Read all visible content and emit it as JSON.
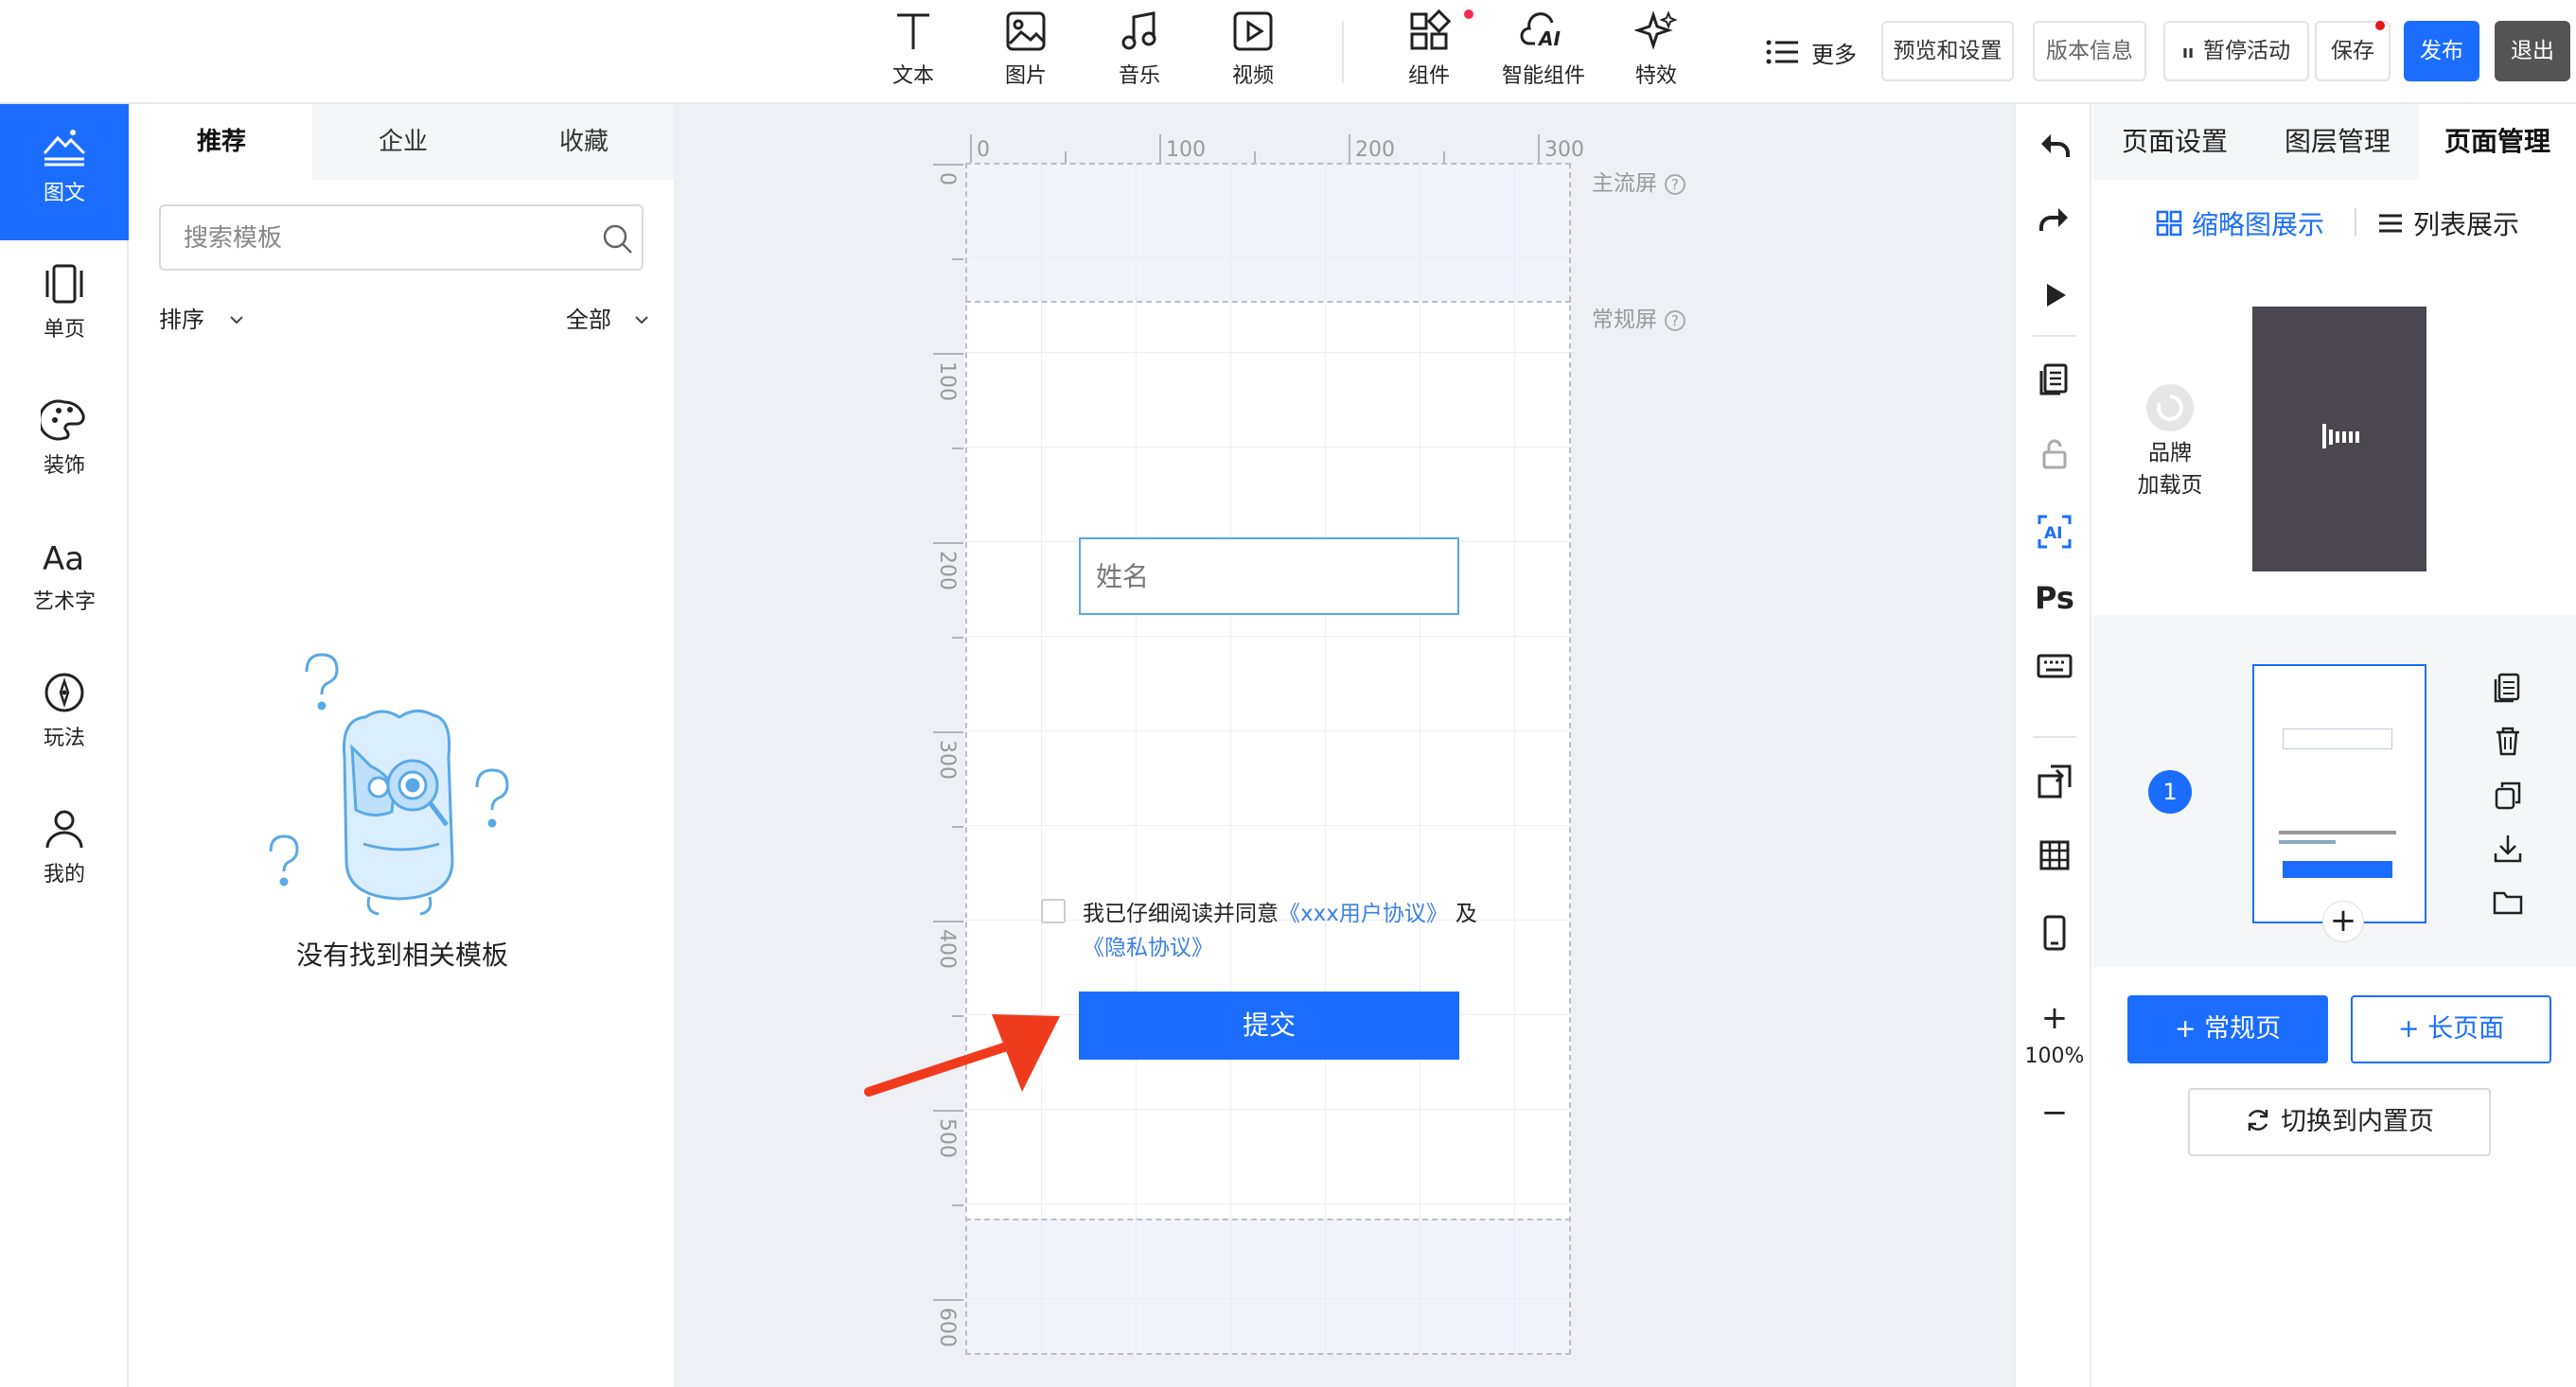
{
  "toolbar": {
    "tools": [
      {
        "label": "文本",
        "icon": "text-icon"
      },
      {
        "label": "图片",
        "icon": "image-icon"
      },
      {
        "label": "音乐",
        "icon": "music-icon"
      },
      {
        "label": "视频",
        "icon": "video-icon"
      },
      {
        "label": "组件",
        "icon": "components-icon"
      },
      {
        "label": "智能组件",
        "icon": "ai-component-icon"
      },
      {
        "label": "特效",
        "icon": "sparkle-icon"
      }
    ],
    "more_label": "更多",
    "preview_label": "预览和设置",
    "version_label": "版本信息",
    "pause_label": "暂停活动",
    "save_label": "保存",
    "publish_label": "发布",
    "exit_label": "退出"
  },
  "left_nav": [
    {
      "label": "图文",
      "icon": "mountain-text-icon",
      "active": true
    },
    {
      "label": "单页",
      "icon": "single-page-icon",
      "active": false
    },
    {
      "label": "装饰",
      "icon": "palette-icon",
      "active": false
    },
    {
      "label": "艺术字",
      "icon": "art-text-icon",
      "active": false
    },
    {
      "label": "玩法",
      "icon": "compass-icon",
      "active": false
    },
    {
      "label": "我的",
      "icon": "user-icon",
      "active": false
    }
  ],
  "template_panel": {
    "tabs": [
      "推荐",
      "企业",
      "收藏"
    ],
    "active_tab": "推荐",
    "search_placeholder": "搜索模板",
    "sort_label": "排序",
    "filter_label": "全部",
    "empty_text": "没有找到相关模板"
  },
  "canvas": {
    "ruler_x": [
      "0",
      "100",
      "200",
      "300"
    ],
    "ruler_y": [
      "0",
      "100",
      "200",
      "300",
      "400",
      "500",
      "600"
    ],
    "main_screen_label": "主流屏",
    "normal_screen_label": "常规屏",
    "form": {
      "name_placeholder": "姓名",
      "agree_text": "我已仔细阅读并同意",
      "agreement_link": "《xxx用户协议》",
      "and_text": "及",
      "privacy_link": "《隐私协议》",
      "submit_label": "提交"
    }
  },
  "vertical_tools": {
    "zoom_in": "+",
    "zoom_level": "100%",
    "zoom_out": "−",
    "ps_label": "Ps",
    "ai_label": "AI"
  },
  "right_panel": {
    "tabs": [
      "页面设置",
      "图层管理",
      "页面管理"
    ],
    "active_tab": "页面管理",
    "view_thumbnail": "缩略图展示",
    "view_list": "列表展示",
    "loading_page_label_1": "品牌",
    "loading_page_label_2": "加载页",
    "page_number": "1",
    "add_page": "+",
    "add_normal_page": "+ 常规页",
    "add_long_page": "+ 长页面",
    "switch_builtin": "切换到内置页"
  },
  "colors": {
    "primary": "#1a6dff",
    "accent_red": "#f5294f",
    "arrow_red": "#f03a1e",
    "canvas_bg": "#eef0f5",
    "loading_bg": "#4a4750"
  }
}
